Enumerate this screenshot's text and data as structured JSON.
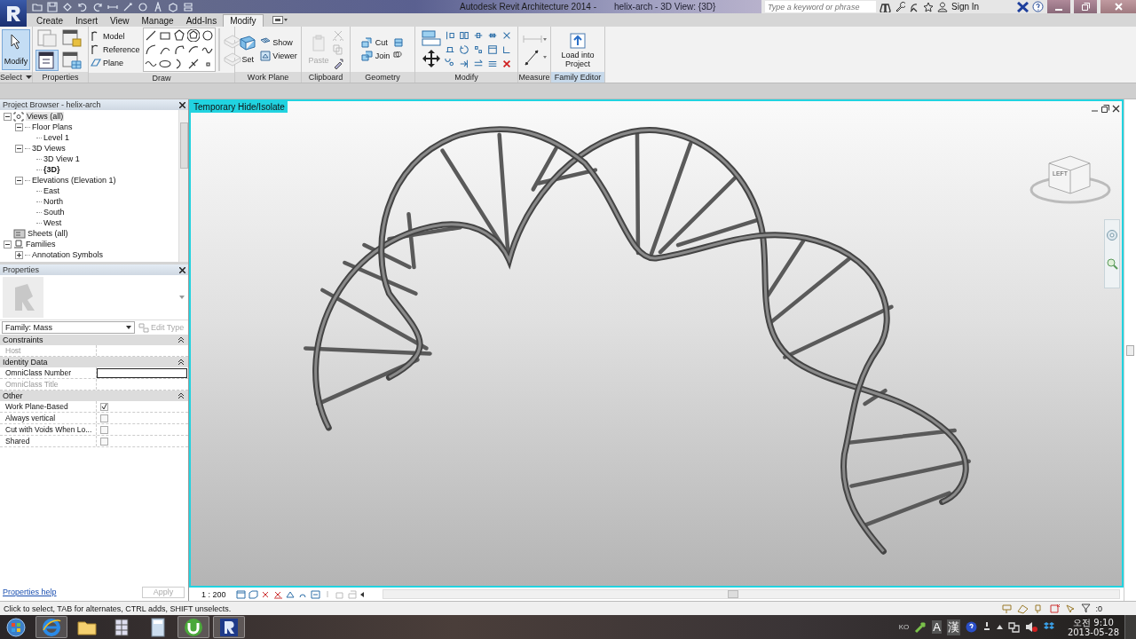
{
  "title_bar": {
    "app_title": "Autodesk Revit Architecture 2014 -",
    "document_title": "helix-arch - 3D View: {3D}",
    "search": {
      "placeholder": "Type a keyword or phrase"
    },
    "sign_in": "Sign In"
  },
  "ribbon_tabs": [
    {
      "label": "Create",
      "selected": false
    },
    {
      "label": "Insert",
      "selected": false
    },
    {
      "label": "View",
      "selected": false
    },
    {
      "label": "Manage",
      "selected": false
    },
    {
      "label": "Add-Ins",
      "selected": false
    },
    {
      "label": "Modify",
      "selected": true
    }
  ],
  "panels": {
    "select": {
      "label": "Select",
      "button": "Modify",
      "selected": true
    },
    "properties": {
      "label": "Properties"
    },
    "draw": {
      "label": "Draw",
      "tools": [
        "Model",
        "Reference",
        "Plane"
      ]
    },
    "work_plane": {
      "label": "Work Plane",
      "set": "Set",
      "tools": [
        "Show",
        "Viewer"
      ]
    },
    "clipboard": {
      "label": "Clipboard",
      "paste": "Paste"
    },
    "geometry": {
      "label": "Geometry",
      "tools": [
        "Cut",
        "Join"
      ]
    },
    "modify": {
      "label": "Modify"
    },
    "measure": {
      "label": "Measure"
    },
    "family_editor": {
      "label": "Family Editor",
      "button": "Load into Project"
    }
  },
  "project_browser": {
    "title": "Project Browser - helix-arch",
    "tree": [
      {
        "label": "Views (all)",
        "kind": "views",
        "expanded": true,
        "children": [
          {
            "label": "Floor Plans",
            "expanded": true,
            "children": [
              {
                "label": "Level 1",
                "current": false
              }
            ]
          },
          {
            "label": "3D Views",
            "expanded": true,
            "children": [
              {
                "label": "3D View 1",
                "current": false
              },
              {
                "label": "{3D}",
                "current": true
              }
            ]
          },
          {
            "label": "Elevations (Elevation 1)",
            "expanded": true,
            "children": [
              {
                "label": "East",
                "current": false
              },
              {
                "label": "North",
                "current": false
              },
              {
                "label": "South",
                "current": false
              },
              {
                "label": "West",
                "current": false
              }
            ]
          }
        ]
      },
      {
        "label": "Sheets (all)",
        "kind": "sheets"
      },
      {
        "label": "Families",
        "kind": "families",
        "expanded": true,
        "children": [
          {
            "label": "Annotation Symbols",
            "expanded": false
          }
        ]
      }
    ]
  },
  "properties": {
    "title": "Properties",
    "type_selector": "Family: Mass",
    "edit_type": "Edit Type",
    "groups": [
      {
        "name": "Constraints",
        "rows": [
          {
            "label": "Host",
            "kind": "text",
            "disabled": true
          }
        ]
      },
      {
        "name": "Identity Data",
        "rows": [
          {
            "label": "OmniClass Number",
            "kind": "field",
            "disabled": false
          },
          {
            "label": "OmniClass Title",
            "kind": "text",
            "disabled": true
          }
        ]
      },
      {
        "name": "Other",
        "rows": [
          {
            "label": "Work Plane-Based",
            "kind": "checkbox",
            "checked": true,
            "disabled": false
          },
          {
            "label": "Always vertical",
            "kind": "checkbox",
            "checked": false,
            "disabled": false
          },
          {
            "label": "Cut with Voids When Lo...",
            "kind": "checkbox",
            "checked": false,
            "disabled": false
          },
          {
            "label": "Shared",
            "kind": "checkbox",
            "checked": false,
            "disabled": false
          }
        ]
      }
    ],
    "help": "Properties help",
    "apply": "Apply"
  },
  "viewport": {
    "label": "Temporary Hide/Isolate",
    "viewcube_face": "LEFT",
    "scale": "1 : 200"
  },
  "status_bar": {
    "message": "Click to select, TAB for alternates, CTRL adds, SHIFT unselects.",
    "filter_count": ":0"
  },
  "taskbar": {
    "apps": [
      {
        "kind": "browser",
        "running": true
      },
      {
        "kind": "folder",
        "running": false
      },
      {
        "kind": "spreadsheet",
        "running": false
      },
      {
        "kind": "calculator",
        "running": false
      },
      {
        "kind": "torrent",
        "running": true
      },
      {
        "kind": "revit",
        "running": true
      }
    ],
    "tray": {
      "language": "KO",
      "ime_mode": "A",
      "hanja": "漢",
      "time": "오전 9:10",
      "date": "2013-05-28"
    }
  }
}
